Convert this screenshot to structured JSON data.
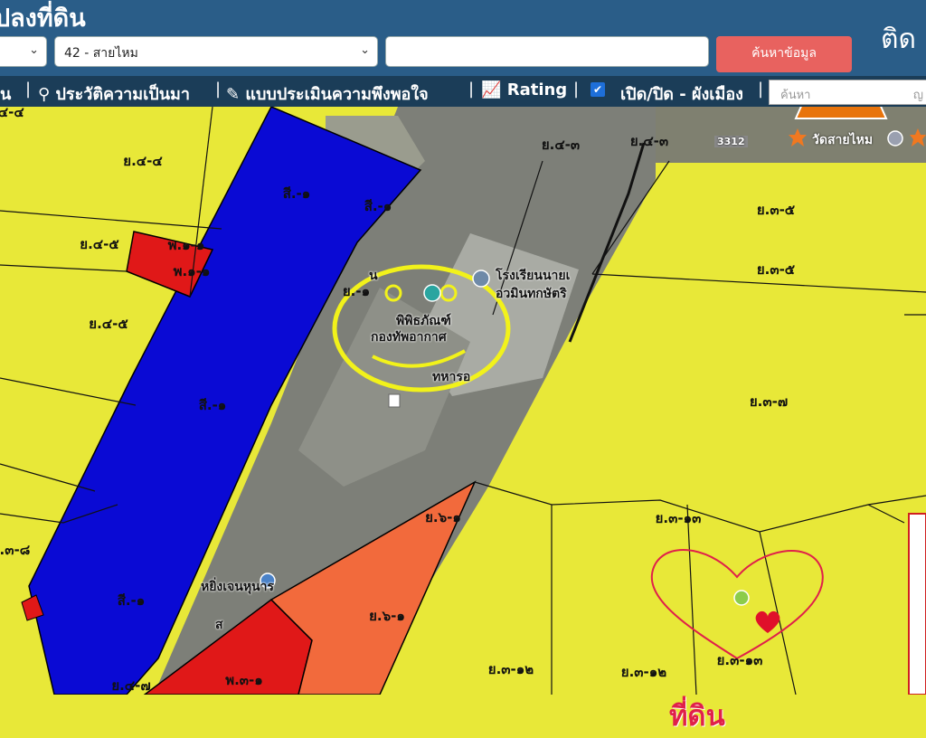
{
  "header": {
    "title": "ปลงที่ดิน",
    "province_select": "",
    "district_select": "42 - สายไหม",
    "search_value": "",
    "search_button": "ค้นหาข้อมูล",
    "contact": "ติด"
  },
  "menu": {
    "item0": "น",
    "history": "ประวัติความเป็นมา",
    "survey": "แบบประเมินความพึงพอใจ",
    "rating": "Rating",
    "layer_toggle": "เปิด/ปิด - ผังเมือง",
    "map_search_placeholder": "ค้นหา",
    "map_search_tail": "ญ"
  },
  "map": {
    "zones": [
      "ย.๔-๔",
      "ย.๔-๕",
      "ย.๔-๕",
      "ย.๔-๓",
      "ย.๔-๓",
      "ย.๓-๕",
      "ย.๓-๕",
      "ย.๓-๗",
      "ย.๓-๑๓",
      "ย.๓-๑๒",
      "ย.๓-๑๒",
      "ย.๓-๑๓",
      "ย.๓-๘",
      "ย.๔-๗",
      "ย.๖-๑",
      "ย.๖-๑",
      "สี.-๑",
      "สี.-๑",
      "สี.-๑",
      "สี.-๑",
      "พ.๑-๑",
      "พ.๑-๑",
      "พ.๓-๑",
      "ย.-๑",
      "ย.๔-๔"
    ],
    "pois": [
      "วัดสายไหม",
      "โรงเรียนนายเ",
      "อวมินทกษัตริ",
      "พิพิธภัณฑ์",
      "กองทัพอากาศ",
      "ทหารอ",
      "หยิ่งเจนหุนาร",
      "น",
      "ส"
    ],
    "road_label": "3312",
    "land_text": "ที่ดิน",
    "colors": {
      "header": "#2a5d88",
      "menubar": "#1b3d58",
      "residential": "#e8e838",
      "conservation": "#0a0ad4",
      "commercial": "#e01818",
      "medium": "#f26a3c",
      "arrow": "#e8740c"
    }
  }
}
